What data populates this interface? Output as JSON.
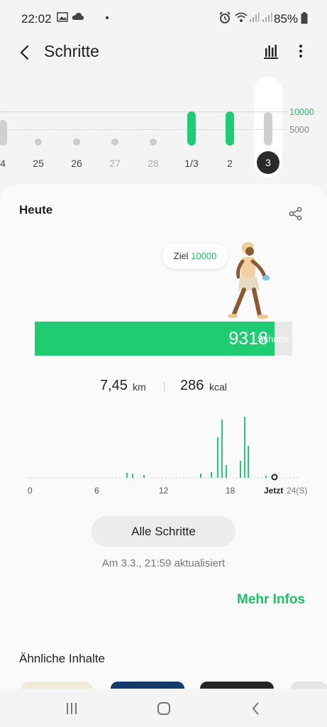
{
  "status_bar": {
    "time": "22:02",
    "battery": "85%"
  },
  "app_bar": {
    "title": "Schritte"
  },
  "week": {
    "reference_labels": {
      "goal": "10000",
      "half": "5000"
    },
    "days": [
      {
        "label": "4",
        "steps": null
      },
      {
        "label": "25",
        "steps": 0
      },
      {
        "label": "26",
        "steps": 0
      },
      {
        "label": "27",
        "steps": 0
      },
      {
        "label": "28",
        "steps": 0
      },
      {
        "label": "1/3",
        "steps": 10000
      },
      {
        "label": "2",
        "steps": 10000
      },
      {
        "label": "3",
        "steps": 9318
      }
    ],
    "selected": "3",
    "colors": {
      "goal_met": "#1fcc71",
      "below_goal": "#cfcfcf"
    }
  },
  "today": {
    "title": "Heute",
    "goal_label": "Ziel",
    "goal_value": "10000",
    "steps": "9318",
    "steps_unit": "Schritte",
    "progress_fraction": 0.93,
    "distance": "7,45",
    "distance_unit": "km",
    "calories": "286",
    "calories_unit": "kcal"
  },
  "hourly_chart": {
    "x_labels": [
      "0",
      "6",
      "12",
      "18"
    ],
    "now_label": "Jetzt",
    "end_label": "24(S)"
  },
  "actions": {
    "all_steps": "Alle Schritte",
    "updated": "Am 3.3., 21:59 aktualisiert",
    "more_info": "Mehr Infos"
  },
  "related": {
    "title": "Ähnliche Inhalte"
  },
  "theme": {
    "accent": "#1fbf6a",
    "bar": "#1fcc71"
  }
}
